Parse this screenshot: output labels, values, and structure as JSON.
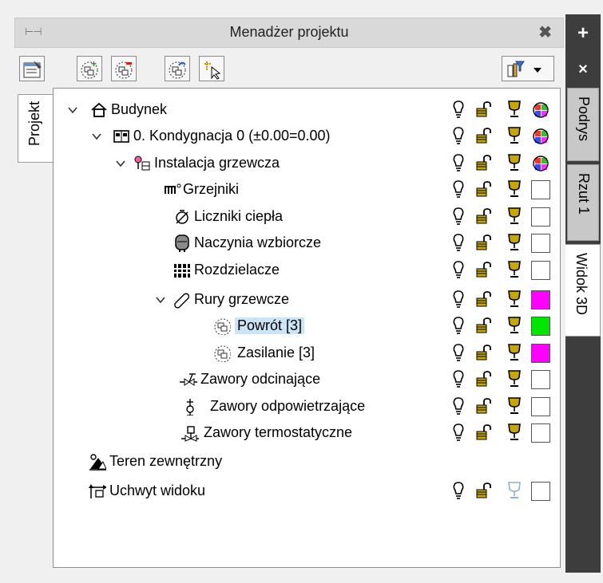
{
  "panel": {
    "title": "Menadżer projektu",
    "pin_glyph": "⊢⊣",
    "close_glyph": "✖"
  },
  "toolbar": {
    "buttons": [
      {
        "name": "properties-icon"
      },
      {
        "name": "add-group-icon"
      },
      {
        "name": "remove-group-icon"
      },
      {
        "name": "copy-group-icon"
      },
      {
        "name": "select-elements-icon"
      },
      {
        "name": "filter-dropdown-icon"
      }
    ]
  },
  "left_tab": {
    "label": "Projekt"
  },
  "right_strip": {
    "plus": "+",
    "close": "×",
    "tabs": [
      "Podrys",
      "Rzut 1",
      "Widok 3D"
    ]
  },
  "colors": {
    "magenta": "#ff00ff",
    "green": "#00e600",
    "selection": "#cce4f7",
    "dark_strip": "#3d3d3d"
  },
  "tree": [
    {
      "label": "Budynek",
      "icon": "house-icon",
      "expanded": true,
      "flags": true,
      "color": "multi"
    },
    {
      "label": "0. Kondygnacja 0 (±0.00=0.00)",
      "icon": "floor-icon",
      "expanded": true,
      "flags": true,
      "color": "multi"
    },
    {
      "label": "Instalacja grzewcza",
      "icon": "heating-install-icon",
      "expanded": true,
      "flags": true,
      "color": "multi"
    },
    {
      "label": "Grzejniki",
      "icon": "radiator-icon",
      "flags": true,
      "color": "none"
    },
    {
      "label": "Liczniki ciepła",
      "icon": "heat-meter-icon",
      "flags": true,
      "color": "none"
    },
    {
      "label": "Naczynia wzbiorcze",
      "icon": "expansion-vessel-icon",
      "flags": true,
      "color": "none"
    },
    {
      "label": "Rozdzielacze",
      "icon": "manifold-icon",
      "flags": true,
      "color": "none"
    },
    {
      "label": "Rury grzewcze",
      "icon": "pipe-icon",
      "expanded": true,
      "flags": true,
      "color": "#ff00ff"
    },
    {
      "label": "Powrót [3]",
      "icon": "group-icon",
      "flags": true,
      "color": "#00e600",
      "selected": true
    },
    {
      "label": "Zasilanie [3]",
      "icon": "group-icon",
      "flags": true,
      "color": "#ff00ff"
    },
    {
      "label": "Zawory odcinające",
      "icon": "shutoff-valve-icon",
      "flags": true,
      "color": "none"
    },
    {
      "label": "Zawory odpowietrzające",
      "icon": "air-vent-valve-icon",
      "flags": true,
      "color": "none"
    },
    {
      "label": "Zawory termostatyczne",
      "icon": "thermostatic-valve-icon",
      "flags": true,
      "color": "none"
    },
    {
      "label": "Teren zewnętrzny",
      "icon": "terrain-icon",
      "flags": false
    },
    {
      "label": "Uchwyt widoku",
      "icon": "view-handle-icon",
      "flags": true,
      "color": "none",
      "dim_cup": true
    }
  ]
}
